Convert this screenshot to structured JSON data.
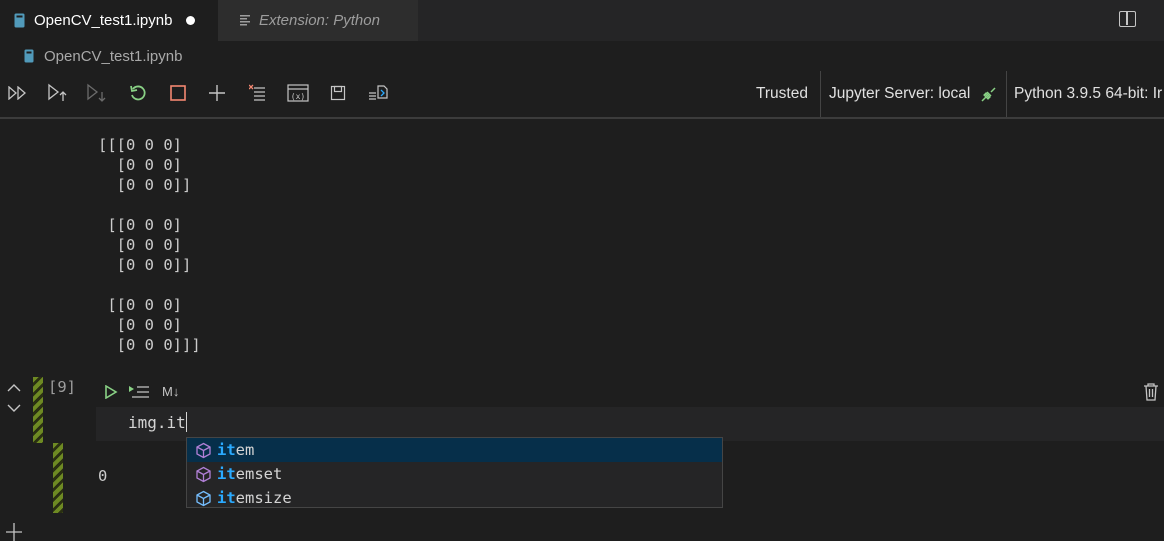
{
  "tabs": [
    {
      "label": "OpenCV_test1.ipynb",
      "modified": true,
      "active": true
    },
    {
      "label": "Extension: Python",
      "active": false
    }
  ],
  "breadcrumb": {
    "file": "OpenCV_test1.ipynb"
  },
  "toolbar": {
    "icons": [
      "run-all-icon",
      "run-above-icon",
      "run-below-icon",
      "restart-kernel-icon",
      "interrupt-kernel-icon",
      "add-cell-icon",
      "clear-outputs-icon",
      "variables-icon",
      "save-icon",
      "export-icon"
    ],
    "trusted_label": "Trusted",
    "server_label": "Jupyter Server: local",
    "kernel_label": "Python 3.9.5 64-bit: Ir"
  },
  "output": {
    "text": "[[[0 0 0]\n  [0 0 0]\n  [0 0 0]]\n\n [[0 0 0]\n  [0 0 0]\n  [0 0 0]]\n\n [[0 0 0]\n  [0 0 0]\n  [0 0 0]]]"
  },
  "cell": {
    "execution_count": "[9]",
    "code": "img.it",
    "language_label": "M↓",
    "output": "0"
  },
  "suggest": {
    "typed_prefix": "it",
    "items": [
      {
        "prefix": "it",
        "rest": "em",
        "selected": true
      },
      {
        "prefix": "it",
        "rest": "emset",
        "selected": false
      },
      {
        "prefix": "it",
        "rest": "emsize",
        "selected": false
      }
    ]
  },
  "colors": {
    "accent": "#2aaaff",
    "run_green": "#89d185",
    "stop_red": "#f48771",
    "cell_bar": "#6e8a23",
    "selection": "#062f4a"
  }
}
